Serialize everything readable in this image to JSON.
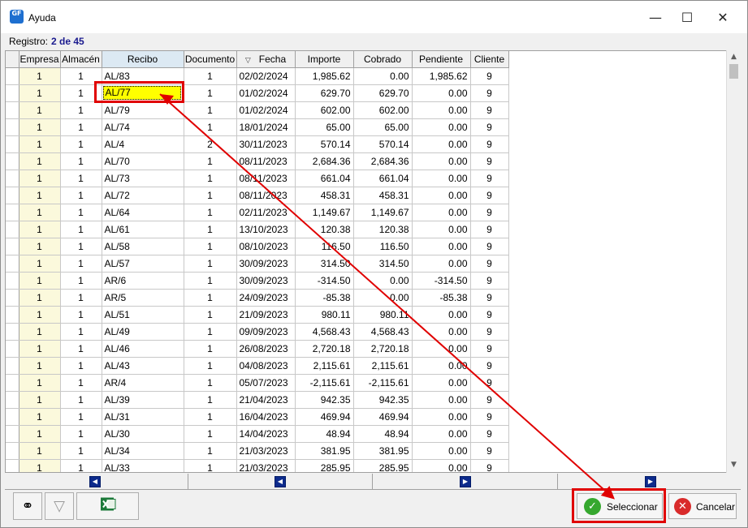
{
  "window": {
    "title": "Ayuda",
    "minimize": "—",
    "maximize": "☐",
    "close": "✕",
    "icon_text": "GF"
  },
  "status": {
    "label": "Registro:",
    "value": "2 de 45"
  },
  "grid": {
    "columns": [
      "Empresa",
      "Almacén",
      "Recibo",
      "Documento",
      "Fecha",
      "Importe",
      "Cobrado",
      "Pendiente",
      "Cliente"
    ],
    "rows": [
      [
        "1",
        "1",
        "AL/83",
        "1",
        "02/02/2024",
        "1,985.62",
        "0.00",
        "1,985.62",
        "9"
      ],
      [
        "1",
        "1",
        "AL/77",
        "1",
        "01/02/2024",
        "629.70",
        "629.70",
        "0.00",
        "9"
      ],
      [
        "1",
        "1",
        "AL/79",
        "1",
        "01/02/2024",
        "602.00",
        "602.00",
        "0.00",
        "9"
      ],
      [
        "1",
        "1",
        "AL/74",
        "1",
        "18/01/2024",
        "65.00",
        "65.00",
        "0.00",
        "9"
      ],
      [
        "1",
        "1",
        "AL/4",
        "2",
        "30/11/2023",
        "570.14",
        "570.14",
        "0.00",
        "9"
      ],
      [
        "1",
        "1",
        "AL/70",
        "1",
        "08/11/2023",
        "2,684.36",
        "2,684.36",
        "0.00",
        "9"
      ],
      [
        "1",
        "1",
        "AL/73",
        "1",
        "08/11/2023",
        "661.04",
        "661.04",
        "0.00",
        "9"
      ],
      [
        "1",
        "1",
        "AL/72",
        "1",
        "08/11/2023",
        "458.31",
        "458.31",
        "0.00",
        "9"
      ],
      [
        "1",
        "1",
        "AL/64",
        "1",
        "02/11/2023",
        "1,149.67",
        "1,149.67",
        "0.00",
        "9"
      ],
      [
        "1",
        "1",
        "AL/61",
        "1",
        "13/10/2023",
        "120.38",
        "120.38",
        "0.00",
        "9"
      ],
      [
        "1",
        "1",
        "AL/58",
        "1",
        "08/10/2023",
        "116.50",
        "116.50",
        "0.00",
        "9"
      ],
      [
        "1",
        "1",
        "AL/57",
        "1",
        "30/09/2023",
        "314.50",
        "314.50",
        "0.00",
        "9"
      ],
      [
        "1",
        "1",
        "AR/6",
        "1",
        "30/09/2023",
        "-314.50",
        "0.00",
        "-314.50",
        "9"
      ],
      [
        "1",
        "1",
        "AR/5",
        "1",
        "24/09/2023",
        "-85.38",
        "0.00",
        "-85.38",
        "9"
      ],
      [
        "1",
        "1",
        "AL/51",
        "1",
        "21/09/2023",
        "980.11",
        "980.11",
        "0.00",
        "9"
      ],
      [
        "1",
        "1",
        "AL/49",
        "1",
        "09/09/2023",
        "4,568.43",
        "4,568.43",
        "0.00",
        "9"
      ],
      [
        "1",
        "1",
        "AL/46",
        "1",
        "26/08/2023",
        "2,720.18",
        "2,720.18",
        "0.00",
        "9"
      ],
      [
        "1",
        "1",
        "AL/43",
        "1",
        "04/08/2023",
        "2,115.61",
        "2,115.61",
        "0.00",
        "9"
      ],
      [
        "1",
        "1",
        "AR/4",
        "1",
        "05/07/2023",
        "-2,115.61",
        "-2,115.61",
        "0.00",
        "9"
      ],
      [
        "1",
        "1",
        "AL/39",
        "1",
        "21/04/2023",
        "942.35",
        "942.35",
        "0.00",
        "9"
      ],
      [
        "1",
        "1",
        "AL/31",
        "1",
        "16/04/2023",
        "469.94",
        "469.94",
        "0.00",
        "9"
      ],
      [
        "1",
        "1",
        "AL/30",
        "1",
        "14/04/2023",
        "48.94",
        "48.94",
        "0.00",
        "9"
      ],
      [
        "1",
        "1",
        "AL/34",
        "1",
        "21/03/2023",
        "381.95",
        "381.95",
        "0.00",
        "9"
      ],
      [
        "1",
        "1",
        "AL/33",
        "1",
        "21/03/2023",
        "285.95",
        "285.95",
        "0.00",
        "9"
      ]
    ],
    "selected_row_index": 1,
    "selected_color": "#ffff00"
  },
  "nav": {
    "first": "◀",
    "prev": "◀",
    "next": "▶",
    "last": "▶"
  },
  "toolbar": {
    "binoculars": "binoculars-icon",
    "filter": "funnel-icon",
    "excel": "excel-icon"
  },
  "buttons": {
    "select_label": "Seleccionar",
    "cancel_label": "Cancelar"
  },
  "colors": {
    "annotation": "#e00000",
    "accent": "#1b1b8f"
  }
}
